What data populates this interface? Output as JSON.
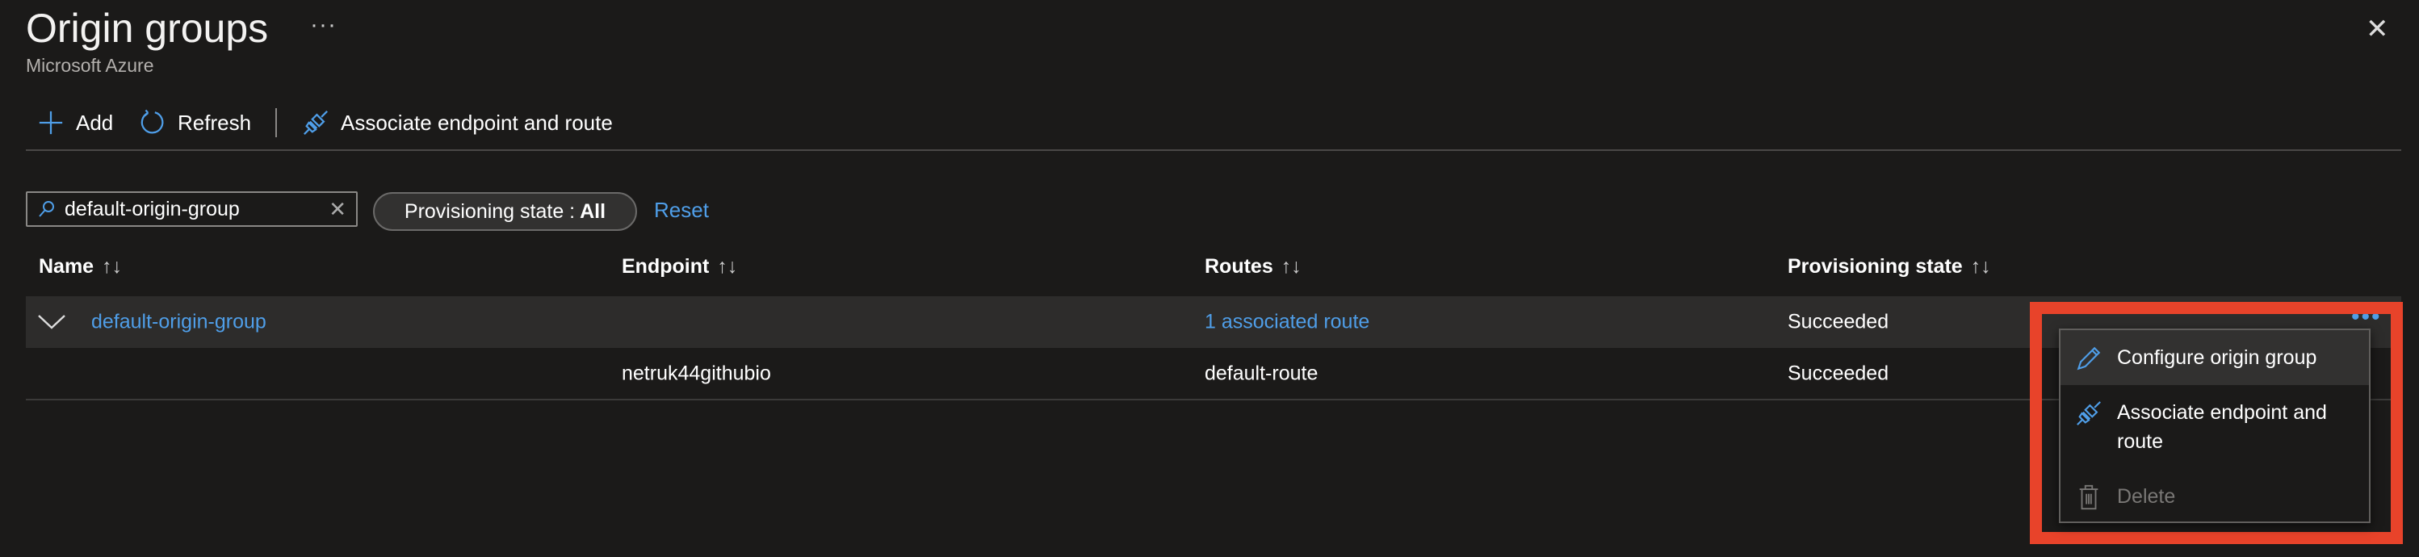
{
  "header": {
    "title": "Origin groups",
    "more": "···",
    "subtitle": "Microsoft Azure",
    "close": "✕"
  },
  "toolbar": {
    "add": "Add",
    "refresh": "Refresh",
    "associate": "Associate endpoint and route"
  },
  "filter": {
    "search_value": "default-origin-group",
    "clear": "✕",
    "pill_label": "Provisioning state :",
    "pill_value": "All",
    "reset": "Reset"
  },
  "table": {
    "columns": [
      "Name",
      "Endpoint",
      "Routes",
      "Provisioning state"
    ],
    "sort": "↑↓",
    "rows": [
      {
        "name": "default-origin-group",
        "endpoint": "",
        "routes": "1 associated route",
        "state": "Succeeded"
      },
      {
        "name": "",
        "endpoint": "netruk44githubio",
        "routes": "default-route",
        "state": "Succeeded"
      }
    ]
  },
  "menu": {
    "items": [
      "Configure origin group",
      "Associate endpoint and route",
      "Delete"
    ]
  },
  "more_dots": "•••",
  "colors": {
    "accent": "#4f9ee8",
    "highlight": "#e8432a"
  }
}
